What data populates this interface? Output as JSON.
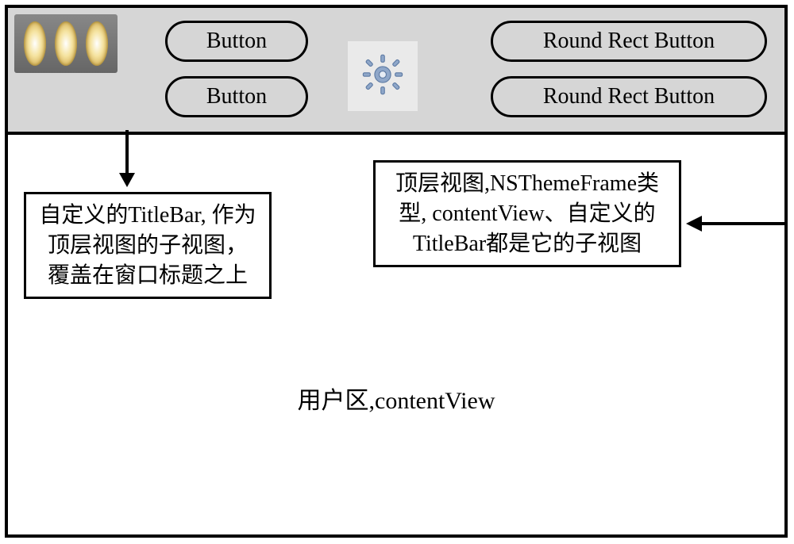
{
  "titlebar": {
    "btn1": "Button",
    "btn2": "Button",
    "btn3": "Round Rect Button",
    "btn4": "Round Rect Button"
  },
  "callouts": {
    "titlebar_note": "自定义的TitleBar, 作为顶层视图的子视图，覆盖在窗口标题之上",
    "themeframe_note": "顶层视图,NSThemeFrame类型, contentView、自定义的TitleBar都是它的子视图"
  },
  "content": {
    "label": "用户区,contentView"
  }
}
